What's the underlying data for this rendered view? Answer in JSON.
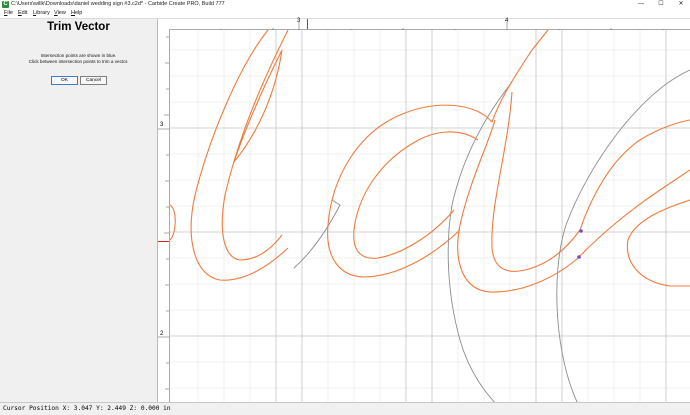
{
  "window": {
    "title": "C:\\Users\\willk\\Downloads\\daniel wedding sign #3.c2d* - Carbide Create PRO, Build 777",
    "app_icon_glyph": "C",
    "controls": {
      "minimize": "—",
      "maximize": "☐",
      "close": "✕"
    }
  },
  "menu": [
    "File",
    "Edit",
    "Library",
    "View",
    "Help"
  ],
  "panel": {
    "title": "Trim Vector",
    "instruction_line1": "Intersection points are shown in blue.",
    "instruction_line2": "Click between intersection points to trim a vector.",
    "ok_label": "OK",
    "cancel_label": "Cancel"
  },
  "rulers": {
    "x_labels": [
      "3",
      "4"
    ],
    "y_labels": [
      "3",
      "2"
    ]
  },
  "status": {
    "text": "Cursor Position X: 3.047 Y: 2.449 Z: 0.000 in"
  },
  "colors": {
    "vector_orange": "#f07b3c",
    "vector_gray": "#8c8c8c",
    "grid_major": "#c4c4c4",
    "grid_minor": "#e6e6e6",
    "intersection_point": "#6a4fd0",
    "ruler_marker": "#e02020"
  }
}
